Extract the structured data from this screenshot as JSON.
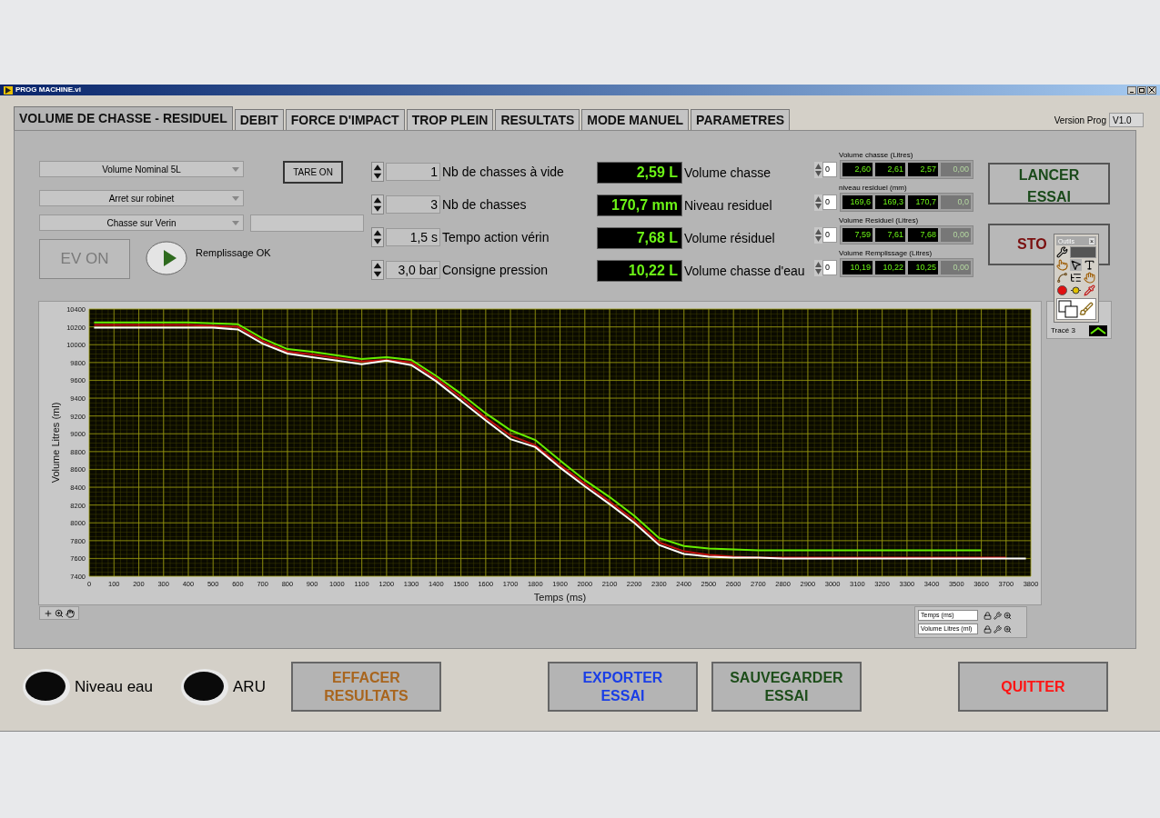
{
  "window": {
    "title": "PROG MACHINE.vi"
  },
  "tabs": [
    {
      "label": "VOLUME DE CHASSE - RESIDUEL",
      "selected": true
    },
    {
      "label": "DEBIT",
      "selected": false
    },
    {
      "label": "FORCE D'IMPACT",
      "selected": false
    },
    {
      "label": "TROP PLEIN",
      "selected": false
    },
    {
      "label": "RESULTATS",
      "selected": false
    },
    {
      "label": "MODE MANUEL",
      "selected": false
    },
    {
      "label": "PARAMETRES",
      "selected": false
    }
  ],
  "version": {
    "label": "Version Prog",
    "value": "V1.0"
  },
  "dropdowns": [
    {
      "value": "Volume Nominal 5L"
    },
    {
      "value": "Arret sur robinet"
    },
    {
      "value": "Chasse sur Verin"
    }
  ],
  "tare_button": {
    "label": "TARE ON"
  },
  "ev_button": {
    "label": "EV ON",
    "disabled": true
  },
  "fill_indicator": {
    "label": "Remplissage OK",
    "on": true
  },
  "numeric_controls": [
    {
      "value": "1",
      "label": "Nb de chasses à vide"
    },
    {
      "value": "3",
      "label": "Nb de chasses"
    },
    {
      "value": "1,5 s",
      "label": "Tempo action vérin"
    },
    {
      "value": "3,0 bar",
      "label": "Consigne pression"
    }
  ],
  "indicators": [
    {
      "value": "2,59 L",
      "label": "Volume chasse"
    },
    {
      "value": "170,7 mm",
      "label": "Niveau residuel"
    },
    {
      "value": "7,68 L",
      "label": "Volume résiduel"
    },
    {
      "value": "10,22 L",
      "label": "Volume chasse d'eau"
    }
  ],
  "arrays": [
    {
      "caption": "Volume chasse (Litres)",
      "index": "0",
      "cells": [
        {
          "value": "2,60",
          "active": true
        },
        {
          "value": "2,61",
          "active": true
        },
        {
          "value": "2,57",
          "active": true
        },
        {
          "value": "0,00",
          "active": false
        }
      ]
    },
    {
      "caption": "niveau residuel (mm)",
      "index": "0",
      "cells": [
        {
          "value": "169,6",
          "active": true
        },
        {
          "value": "169,3",
          "active": true
        },
        {
          "value": "170,7",
          "active": true
        },
        {
          "value": "0,0",
          "active": false
        }
      ]
    },
    {
      "caption": "Volume Residuel (Litres)",
      "index": "0",
      "cells": [
        {
          "value": "7,59",
          "active": true
        },
        {
          "value": "7,61",
          "active": true
        },
        {
          "value": "7,68",
          "active": true
        },
        {
          "value": "0,00",
          "active": false
        }
      ]
    },
    {
      "caption": "Volume Remplissage (Litres)",
      "index": "0",
      "cells": [
        {
          "value": "10,19",
          "active": true
        },
        {
          "value": "10,22",
          "active": true
        },
        {
          "value": "10,25",
          "active": true
        },
        {
          "value": "0,00",
          "active": false
        }
      ]
    }
  ],
  "action_buttons": [
    {
      "label": "LANCER ESSAI",
      "color": "#1a4a1a"
    },
    {
      "label": "STO",
      "color": "#7a1010"
    }
  ],
  "tools_palette": {
    "title": "Outils",
    "close": "×"
  },
  "graph": {
    "chart_data": {
      "type": "line",
      "xlabel": "Temps (ms)",
      "ylabel": "Volume Litres (ml)",
      "x": [
        20,
        100,
        200,
        300,
        400,
        500,
        600,
        700,
        800,
        900,
        1000,
        1100,
        1200,
        1300,
        1400,
        1500,
        1600,
        1700,
        1800,
        1900,
        2000,
        2100,
        2200,
        2300,
        2400,
        2500,
        2600,
        2700,
        2800,
        2900,
        3000,
        3100,
        3200,
        3300,
        3400,
        3500,
        3600,
        3700,
        3780
      ],
      "series": [
        {
          "name": "Tracé 3",
          "color": "#66ee00",
          "values": [
            10250,
            10250,
            10250,
            10250,
            10250,
            10240,
            10230,
            10070,
            9950,
            9920,
            9880,
            9840,
            9860,
            9830,
            9650,
            9450,
            9230,
            9040,
            8930,
            8700,
            8480,
            8290,
            8080,
            7830,
            7740,
            7710,
            7700,
            7690,
            7690,
            7690,
            7690,
            7690,
            7690,
            7690,
            7690,
            7690,
            7690,
            null,
            null
          ]
        },
        {
          "color": "#c01010",
          "values": [
            10220,
            10220,
            10220,
            10220,
            10220,
            10210,
            10200,
            10040,
            9920,
            9890,
            9850,
            9810,
            9830,
            9800,
            9620,
            9410,
            9180,
            8980,
            8870,
            8650,
            8440,
            8240,
            8030,
            7780,
            7680,
            7640,
            7620,
            7610,
            7610,
            7610,
            7610,
            7610,
            7610,
            7610,
            7610,
            7610,
            7610,
            7610,
            null
          ]
        },
        {
          "color": "#ffffff",
          "values": [
            10190,
            10190,
            10190,
            10190,
            10190,
            10190,
            10170,
            10010,
            9900,
            9860,
            9820,
            9780,
            9820,
            9770,
            9590,
            9370,
            9150,
            8940,
            8850,
            8620,
            8410,
            8210,
            8000,
            7750,
            7650,
            7620,
            7610,
            7610,
            7600,
            7600,
            7600,
            7600,
            7600,
            7600,
            7600,
            7600,
            7600,
            7600,
            7600
          ]
        }
      ],
      "grid": true,
      "xlim": [
        0,
        3800
      ],
      "ylim": [
        7400,
        10400
      ],
      "xticks": [
        0,
        100,
        200,
        300,
        400,
        500,
        600,
        700,
        800,
        900,
        1000,
        1100,
        1200,
        1300,
        1400,
        1500,
        1600,
        1700,
        1800,
        1900,
        2000,
        2100,
        2200,
        2300,
        2400,
        2500,
        2600,
        2700,
        2800,
        2900,
        3000,
        3100,
        3200,
        3300,
        3400,
        3500,
        3600,
        3700,
        3800
      ],
      "yticks": [
        7400,
        7600,
        7800,
        8000,
        8200,
        8400,
        8600,
        8800,
        9000,
        9200,
        9400,
        9600,
        9800,
        10000,
        10200,
        10400
      ]
    }
  },
  "scale_legend": [
    {
      "label": "Temps (ms)"
    },
    {
      "label": "Volume Litres (ml)"
    }
  ],
  "leds": [
    {
      "label": "Niveau eau",
      "on": false
    },
    {
      "label": "ARU",
      "on": false
    }
  ],
  "bottom_buttons": [
    {
      "label": "EFFACER\nRESULTATS",
      "color": "#a8651e"
    },
    {
      "label": "EXPORTER\nESSAI",
      "color": "#1a3ee6"
    },
    {
      "label": "SAUVEGARDER\nESSAI",
      "color": "#1d4d1a"
    },
    {
      "label": "QUITTER",
      "color": "#ff1414"
    }
  ]
}
